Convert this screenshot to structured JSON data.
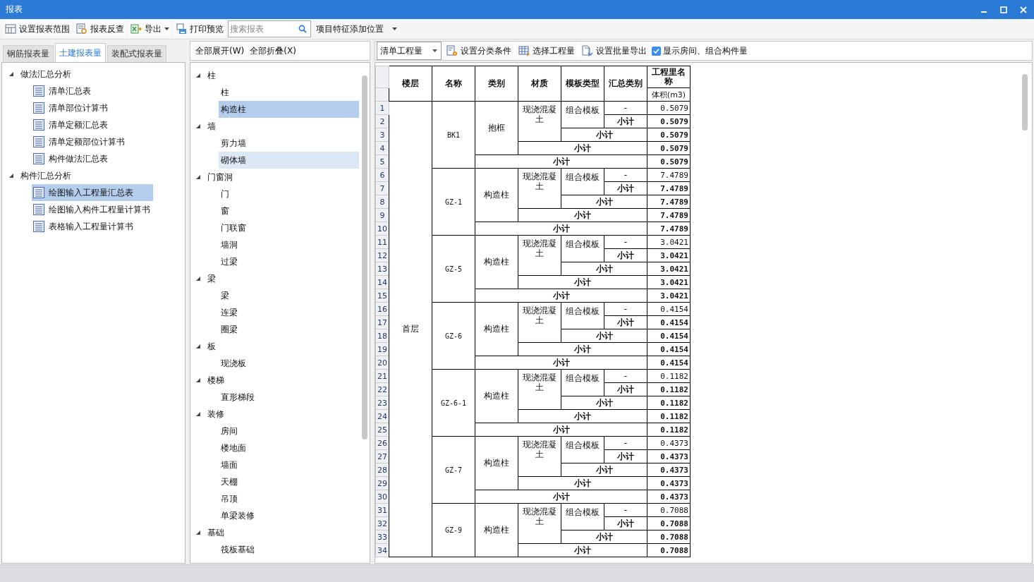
{
  "window": {
    "title": "报表"
  },
  "toolbar": [
    {
      "kind": "button",
      "label": "设置报表范围"
    },
    {
      "kind": "button",
      "label": "报表反查"
    },
    {
      "kind": "menu-button",
      "label": "导出"
    },
    {
      "kind": "button",
      "label": "打印预览"
    },
    {
      "kind": "search",
      "placeholder": "搜索报表"
    },
    {
      "kind": "dropdown",
      "label": "项目特征添加位置"
    }
  ],
  "report_tabs": [
    {
      "label": "钢筋报表量",
      "selected": false
    },
    {
      "label": "土建报表量",
      "selected": true
    },
    {
      "label": "装配式报表量",
      "selected": false
    }
  ],
  "report_tree": [
    {
      "label": "做法汇总分析",
      "expanded": true,
      "children": [
        {
          "label": "清单汇总表",
          "selected": false
        },
        {
          "label": "清单部位计算书",
          "selected": false
        },
        {
          "label": "清单定额汇总表",
          "selected": false
        },
        {
          "label": "清单定额部位计算书",
          "selected": false
        },
        {
          "label": "构件做法汇总表",
          "selected": false
        }
      ]
    },
    {
      "label": "构件汇总分析",
      "expanded": true,
      "children": [
        {
          "label": "绘图输入工程量汇总表",
          "selected": true
        },
        {
          "label": "绘图输入构件工程量计算书",
          "selected": false
        },
        {
          "label": "表格输入工程量计算书",
          "selected": false
        }
      ]
    }
  ],
  "category_actions": [
    "全部展开(W)",
    "全部折叠(X)"
  ],
  "category_tree": [
    {
      "label": "柱",
      "expanded": true,
      "children": [
        {
          "label": "柱",
          "selected": false,
          "highlighted": false
        },
        {
          "label": "构造柱",
          "selected": true,
          "highlighted": false
        }
      ]
    },
    {
      "label": "墙",
      "expanded": true,
      "children": [
        {
          "label": "剪力墙",
          "selected": false,
          "highlighted": false
        },
        {
          "label": "砌体墙",
          "selected": false,
          "highlighted": true
        }
      ]
    },
    {
      "label": "门窗洞",
      "expanded": true,
      "children": [
        {
          "label": "门",
          "selected": false,
          "highlighted": false
        },
        {
          "label": "窗",
          "selected": false,
          "highlighted": false
        },
        {
          "label": "门联窗",
          "selected": false,
          "highlighted": false
        },
        {
          "label": "墙洞",
          "selected": false,
          "highlighted": false
        },
        {
          "label": "过梁",
          "selected": false,
          "highlighted": false
        }
      ]
    },
    {
      "label": "梁",
      "expanded": true,
      "children": [
        {
          "label": "梁",
          "selected": false,
          "highlighted": false
        },
        {
          "label": "连梁",
          "selected": false,
          "highlighted": false
        },
        {
          "label": "圈梁",
          "selected": false,
          "highlighted": false
        }
      ]
    },
    {
      "label": "板",
      "expanded": true,
      "children": [
        {
          "label": "现浇板",
          "selected": false,
          "highlighted": false
        }
      ]
    },
    {
      "label": "楼梯",
      "expanded": true,
      "children": [
        {
          "label": "直形梯段",
          "selected": false,
          "highlighted": false
        }
      ]
    },
    {
      "label": "装修",
      "expanded": true,
      "children": [
        {
          "label": "房间",
          "selected": false,
          "highlighted": false
        },
        {
          "label": "楼地面",
          "selected": false,
          "highlighted": false
        },
        {
          "label": "墙面",
          "selected": false,
          "highlighted": false
        },
        {
          "label": "天棚",
          "selected": false,
          "highlighted": false
        },
        {
          "label": "吊顶",
          "selected": false,
          "highlighted": false
        },
        {
          "label": "单梁装修",
          "selected": false,
          "highlighted": false
        }
      ]
    },
    {
      "label": "基础",
      "expanded": true,
      "children": [
        {
          "label": "筏板基础",
          "selected": false,
          "highlighted": false
        }
      ]
    }
  ],
  "table_toolbar": {
    "quantity_select": "清单工程量",
    "buttons": [
      "设置分类条件",
      "选择工程量",
      "设置批量导出"
    ],
    "checkbox": {
      "label": "显示房间、组合构件量",
      "checked": true
    }
  },
  "report_table": {
    "columns": [
      "楼层",
      "名称",
      "类别",
      "材质",
      "模板类型",
      "汇总类别"
    ],
    "quantity_header": "工程里名称",
    "unit_header": "体积(m3)",
    "floor": "首层",
    "groups": [
      {
        "name": "BK1",
        "category": "抱框",
        "material": "现浇混凝土",
        "formwork": "组合模板",
        "rows": [
          {
            "no": "1",
            "kind": "item",
            "label": "-",
            "value": "0.5079"
          },
          {
            "no": "2",
            "kind": "sub-summary",
            "label": "小计",
            "value": "0.5079"
          },
          {
            "no": "3",
            "kind": "sub-formwork",
            "label": "小计",
            "value": "0.5079"
          },
          {
            "no": "4",
            "kind": "sub-material",
            "label": "小计",
            "value": "0.5079"
          },
          {
            "no": "5",
            "kind": "sub-category",
            "label": "小计",
            "value": "0.5079"
          }
        ]
      },
      {
        "name": "GZ-1",
        "category": "构造柱",
        "material": "现浇混凝土",
        "formwork": "组合模板",
        "rows": [
          {
            "no": "6",
            "kind": "item",
            "label": "-",
            "value": "7.4789"
          },
          {
            "no": "7",
            "kind": "sub-summary",
            "label": "小计",
            "value": "7.4789"
          },
          {
            "no": "8",
            "kind": "sub-formwork",
            "label": "小计",
            "value": "7.4789"
          },
          {
            "no": "9",
            "kind": "sub-material",
            "label": "小计",
            "value": "7.4789"
          },
          {
            "no": "10",
            "kind": "sub-category",
            "label": "小计",
            "value": "7.4789"
          }
        ]
      },
      {
        "name": "GZ-5",
        "category": "构造柱",
        "material": "现浇混凝土",
        "formwork": "组合模板",
        "rows": [
          {
            "no": "11",
            "kind": "item",
            "label": "-",
            "value": "3.0421"
          },
          {
            "no": "12",
            "kind": "sub-summary",
            "label": "小计",
            "value": "3.0421"
          },
          {
            "no": "13",
            "kind": "sub-formwork",
            "label": "小计",
            "value": "3.0421"
          },
          {
            "no": "14",
            "kind": "sub-material",
            "label": "小计",
            "value": "3.0421"
          },
          {
            "no": "15",
            "kind": "sub-category",
            "label": "小计",
            "value": "3.0421"
          }
        ]
      },
      {
        "name": "GZ-6",
        "category": "构造柱",
        "material": "现浇混凝土",
        "formwork": "组合模板",
        "rows": [
          {
            "no": "16",
            "kind": "item",
            "label": "-",
            "value": "0.4154"
          },
          {
            "no": "17",
            "kind": "sub-summary",
            "label": "小计",
            "value": "0.4154"
          },
          {
            "no": "18",
            "kind": "sub-formwork",
            "label": "小计",
            "value": "0.4154"
          },
          {
            "no": "19",
            "kind": "sub-material",
            "label": "小计",
            "value": "0.4154"
          },
          {
            "no": "20",
            "kind": "sub-category",
            "label": "小计",
            "value": "0.4154"
          }
        ]
      },
      {
        "name": "GZ-6-1",
        "category": "构造柱",
        "material": "现浇混凝土",
        "formwork": "组合模板",
        "rows": [
          {
            "no": "21",
            "kind": "item",
            "label": "-",
            "value": "0.1182"
          },
          {
            "no": "22",
            "kind": "sub-summary",
            "label": "小计",
            "value": "0.1182"
          },
          {
            "no": "23",
            "kind": "sub-formwork",
            "label": "小计",
            "value": "0.1182"
          },
          {
            "no": "24",
            "kind": "sub-material",
            "label": "小计",
            "value": "0.1182"
          },
          {
            "no": "25",
            "kind": "sub-category",
            "label": "小计",
            "value": "0.1182"
          }
        ]
      },
      {
        "name": "GZ-7",
        "category": "构造柱",
        "material": "现浇混凝土",
        "formwork": "组合模板",
        "rows": [
          {
            "no": "26",
            "kind": "item",
            "label": "-",
            "value": "0.4373"
          },
          {
            "no": "27",
            "kind": "sub-summary",
            "label": "小计",
            "value": "0.4373"
          },
          {
            "no": "28",
            "kind": "sub-formwork",
            "label": "小计",
            "value": "0.4373"
          },
          {
            "no": "29",
            "kind": "sub-material",
            "label": "小计",
            "value": "0.4373"
          },
          {
            "no": "30",
            "kind": "sub-category",
            "label": "小计",
            "value": "0.4373"
          }
        ]
      },
      {
        "name": "GZ-9",
        "category": "构造柱",
        "material": "现浇混凝土",
        "formwork": "组合模板",
        "rows": [
          {
            "no": "31",
            "kind": "item",
            "label": "-",
            "value": "0.7088"
          },
          {
            "no": "32",
            "kind": "sub-summary",
            "label": "小计",
            "value": "0.7088"
          },
          {
            "no": "33",
            "kind": "sub-formwork",
            "label": "小计",
            "value": "0.7088"
          },
          {
            "no": "34",
            "kind": "sub-material",
            "label": "小计",
            "value": "0.7088"
          }
        ]
      }
    ]
  }
}
